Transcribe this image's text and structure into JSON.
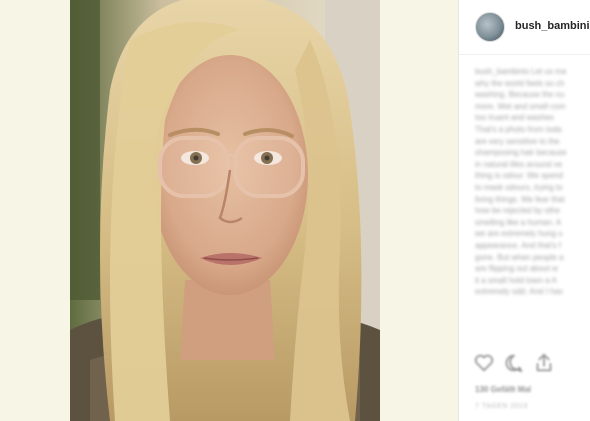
{
  "post": {
    "username": "bush_bambinis",
    "caption_lines": [
      "bush_bambinis Let us ma",
      "why the world feels so ch",
      "washing. Because the nu",
      "more. Wet and smell com",
      "too truant and washes",
      "That's a photo from toda",
      "are very sensitive to the",
      "shampooing hair because",
      "in natural lifes around ve",
      "thing is odour. We spend",
      "to mask odours, trying to",
      "living things. We fear that",
      "how be rejected by othe",
      "smelling like a human. A",
      "we are extremely hung u",
      "appearance. And that's f",
      "gone. But when people a",
      "are flipping out about w",
      "it a small hold town a A",
      "extremely odd. And I hav"
    ],
    "likes": "130 Gefällt Mal",
    "date": "7 TAGEN 2019"
  },
  "colors": {
    "page_background": "#f7f6e6",
    "panel_background": "#ffffff",
    "username_text": "#262626"
  },
  "icons": [
    "heart-icon",
    "comment-icon",
    "share-icon"
  ]
}
